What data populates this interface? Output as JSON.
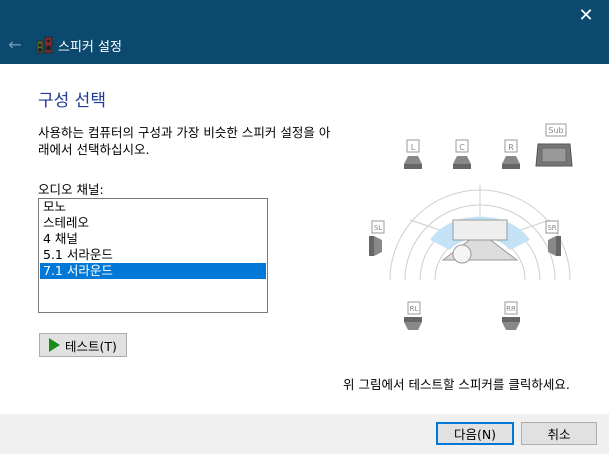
{
  "window": {
    "title": "스피커 설정",
    "close_glyph": "✕",
    "back_glyph": "←"
  },
  "heading": "구성 선택",
  "description": "사용하는 컴퓨터의 구성과 가장 비슷한 스피커 설정을 아래에서 선택하십시오.",
  "channels": {
    "label": "오디오 채널:",
    "options": [
      "모노",
      "스테레오",
      "4 채널",
      "5.1 서라운드",
      "7.1 서라운드"
    ],
    "selected": "7.1 서라운드"
  },
  "test_button": {
    "label": "테스트(T)"
  },
  "speaker_labels": {
    "L": "L",
    "C": "C",
    "R": "R",
    "Sub": "Sub",
    "SL": "SL",
    "SR": "SR",
    "RL": "RL",
    "RR": "RR"
  },
  "hint": "위 그림에서 테스트할 스피커를 클릭하세요.",
  "footer": {
    "next": "다음(N)",
    "cancel": "취소"
  },
  "colors": {
    "titlebar": "#0b4a6e",
    "accent": "#0078d7",
    "heading": "#1f3a93",
    "play": "#1a8c1a"
  }
}
